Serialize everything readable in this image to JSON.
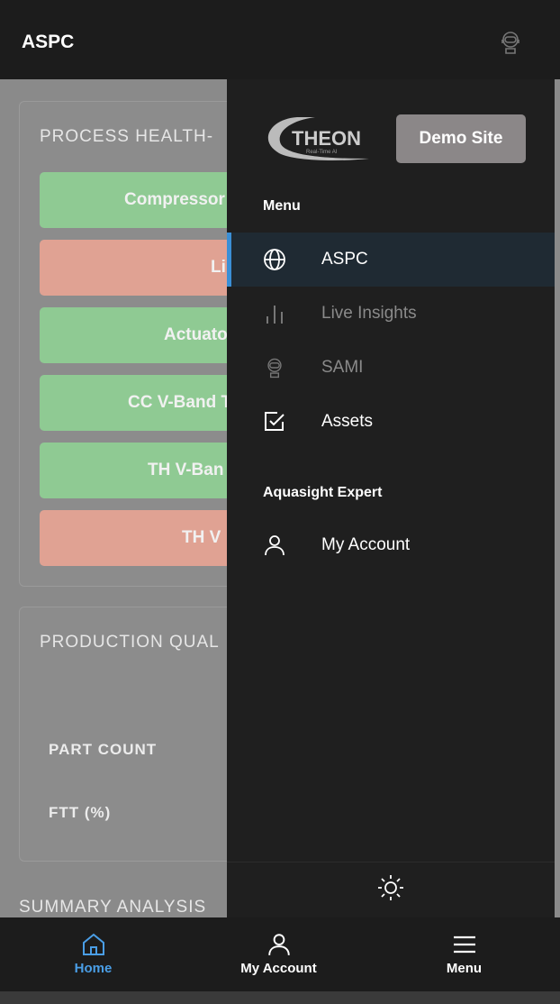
{
  "header": {
    "title": "ASPC",
    "icon": "robot-headset-icon"
  },
  "background": {
    "process_health": {
      "title": "PROCESS HEALTH-",
      "items": [
        {
          "label": "Compressor",
          "status": "good"
        },
        {
          "label": "Li",
          "status": "bad"
        },
        {
          "label": "Actuato",
          "status": "good"
        },
        {
          "label": "CC V-Band T",
          "status": "good"
        },
        {
          "label": "TH V-Ban",
          "status": "good"
        },
        {
          "label": "TH V",
          "status": "bad"
        }
      ]
    },
    "production_quality": {
      "title": "PRODUCTION QUAL",
      "part_count_label": "PART COUNT",
      "ftt_label": "FTT (%)"
    },
    "summary_title": "SUMMARY ANALYSIS"
  },
  "drawer": {
    "logo_text": "THEON",
    "logo_sub": "Real-Time AI",
    "site_button": "Demo Site",
    "menu_title": "Menu",
    "items": [
      {
        "label": "ASPC",
        "icon": "globe-icon",
        "active": true
      },
      {
        "label": "Live Insights",
        "icon": "bar-chart-icon",
        "disabled": true
      },
      {
        "label": "SAMI",
        "icon": "robot-headset-icon",
        "disabled": true
      },
      {
        "label": "Assets",
        "icon": "checkbox-icon"
      }
    ],
    "expert_title": "Aquasight Expert",
    "account": {
      "label": "My Account",
      "icon": "user-icon"
    },
    "theme_icon": "sun-icon"
  },
  "bottom_nav": [
    {
      "label": "Home",
      "icon": "home-icon",
      "active": true
    },
    {
      "label": "My Account",
      "icon": "user-icon"
    },
    {
      "label": "Menu",
      "icon": "hamburger-icon"
    }
  ],
  "colors": {
    "good": "#8fca93",
    "bad": "#e0a293",
    "accent": "#3b8fd6"
  }
}
